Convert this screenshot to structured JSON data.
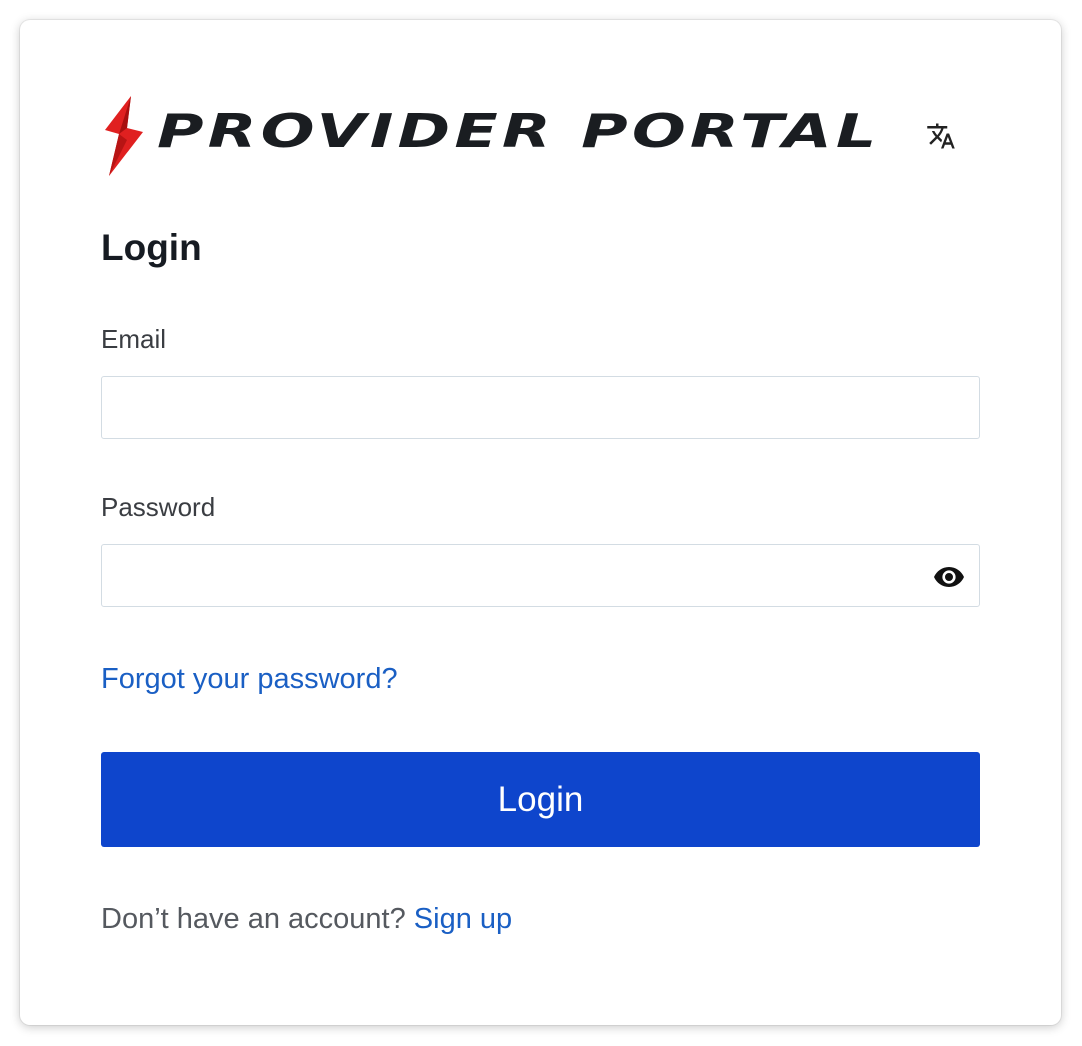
{
  "brand": {
    "logo_text": "PROVIDER PORTAL",
    "logo_icon": "lightning-bolt-icon",
    "accent_color": "#e02020"
  },
  "language_button": {
    "icon": "translate-icon"
  },
  "form": {
    "title": "Login",
    "email": {
      "label": "Email",
      "value": "",
      "placeholder": ""
    },
    "password": {
      "label": "Password",
      "value": "",
      "placeholder": "",
      "toggle_icon": "eye-icon"
    },
    "forgot_password_link": "Forgot your password?",
    "submit_label": "Login",
    "submit_color": "#0e45cc",
    "signup_prompt": "Don’t have an account?",
    "signup_link": "Sign up"
  }
}
